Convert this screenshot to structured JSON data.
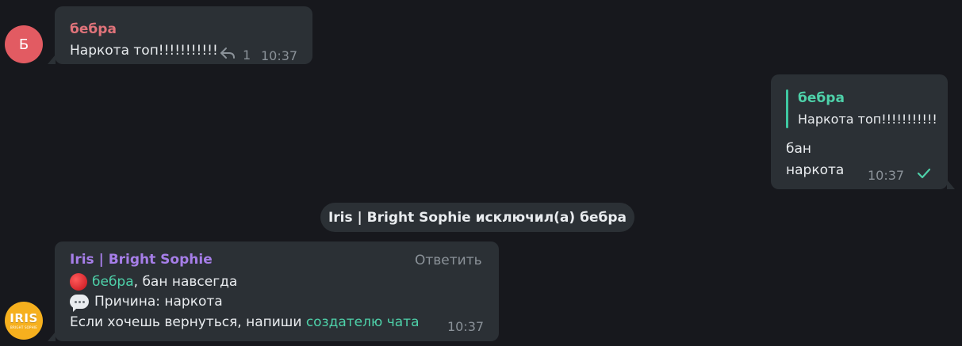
{
  "colors": {
    "background": "#17181d",
    "bubble": "#2b3035",
    "accent_green": "#4ed1a9",
    "sender_red": "#e0737a",
    "sender_purple": "#a67ee8",
    "muted": "#8b9299",
    "avatar_b": "#e25b62",
    "avatar_iris": "#f6b01e"
  },
  "messages": [
    {
      "avatar": "Б",
      "sender": "бебра",
      "text": "Наркота топ!!!!!!!!!!!",
      "reply_icon": "reply-arrow-icon",
      "replies": "1",
      "time": "10:37"
    },
    {
      "quote": {
        "sender": "бебра",
        "text": "Наркота топ!!!!!!!!!!!"
      },
      "lines": [
        "бан",
        "наркота"
      ],
      "time": "10:37",
      "status_icon": "checkmark-icon"
    }
  ],
  "service": {
    "text": "Iris | Bright Sophie исключил(а) бебра"
  },
  "bot_message": {
    "avatar_text": "IRIS",
    "avatar_subtext": "BRIGHT SOPHIE",
    "sender": "Iris | Bright Sophie",
    "reply_label": "Ответить",
    "line1_icon": "red-circle-icon",
    "line1_user": "бебра",
    "line1_rest": ", бан навсегда",
    "line2_icon": "speech-bubble-icon",
    "line2_text": "Причина: наркота",
    "line3_text": "Если хочешь вернуться, напиши ",
    "line3_link": "создателю чата",
    "time": "10:37"
  }
}
